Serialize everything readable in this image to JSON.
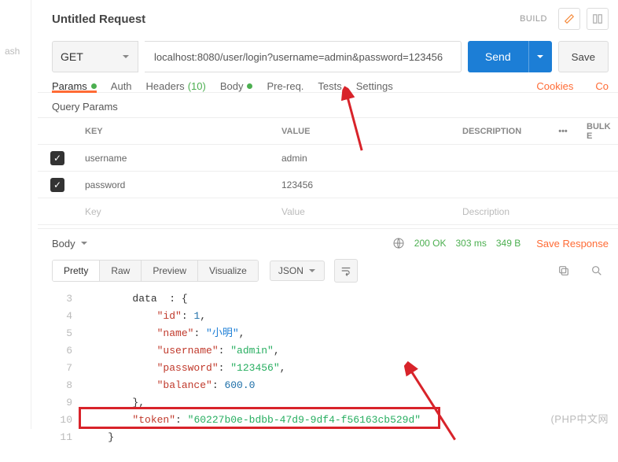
{
  "leftStrip": {
    "label": "ash"
  },
  "header": {
    "title": "Untitled Request",
    "build": "BUILD"
  },
  "request": {
    "method": "GET",
    "url": "localhost:8080/user/login?username=admin&password=123456",
    "send": "Send",
    "save": "Save"
  },
  "tabs": {
    "params": "Params",
    "auth": "Auth",
    "headers": "Headers",
    "headersCount": "(10)",
    "body": "Body",
    "prereq": "Pre-req.",
    "tests": "Tests",
    "settings": "Settings",
    "cookies": "Cookies",
    "co": "Co"
  },
  "paramsSection": {
    "title": "Query Params",
    "headers": {
      "key": "KEY",
      "value": "VALUE",
      "desc": "DESCRIPTION",
      "bulk": "Bulk E"
    },
    "rows": [
      {
        "key": "username",
        "value": "admin"
      },
      {
        "key": "password",
        "value": "123456"
      }
    ],
    "placeholder": {
      "key": "Key",
      "value": "Value",
      "desc": "Description"
    }
  },
  "response": {
    "tab": "Body",
    "status": "200 OK",
    "time": "303 ms",
    "size": "349 B",
    "saveLink": "Save Response"
  },
  "viewer": {
    "pretty": "Pretty",
    "raw": "Raw",
    "preview": "Preview",
    "visualize": "Visualize",
    "format": "JSON"
  },
  "code": {
    "lines": [
      {
        "n": "4",
        "indent": "            ",
        "key": "\"id\"",
        "sep": ": ",
        "val": "1",
        "valClass": "n",
        "tail": ","
      },
      {
        "n": "5",
        "indent": "            ",
        "key": "\"name\"",
        "sep": ": ",
        "val": "\"小明\"",
        "valClass": "blue",
        "tail": ","
      },
      {
        "n": "6",
        "indent": "            ",
        "key": "\"username\"",
        "sep": ": ",
        "val": "\"admin\"",
        "valClass": "s",
        "tail": ","
      },
      {
        "n": "7",
        "indent": "            ",
        "key": "\"password\"",
        "sep": ": ",
        "val": "\"123456\"",
        "valClass": "s",
        "tail": ","
      },
      {
        "n": "8",
        "indent": "            ",
        "key": "\"balance\"",
        "sep": ": ",
        "val": "600.0",
        "valClass": "n",
        "tail": ""
      },
      {
        "n": "9",
        "braceOnly": "        },"
      },
      {
        "n": "10",
        "indent": "        ",
        "key": "\"token\"",
        "sep": ": ",
        "val": "\"60227b0e-bdbb-47d9-9df4-f56163cb529d\"",
        "valClass": "s",
        "tail": ""
      },
      {
        "n": "11",
        "braceOnly": "    }"
      }
    ],
    "dataTop": "        data  : {"
  },
  "watermark": "(PHP中文网"
}
